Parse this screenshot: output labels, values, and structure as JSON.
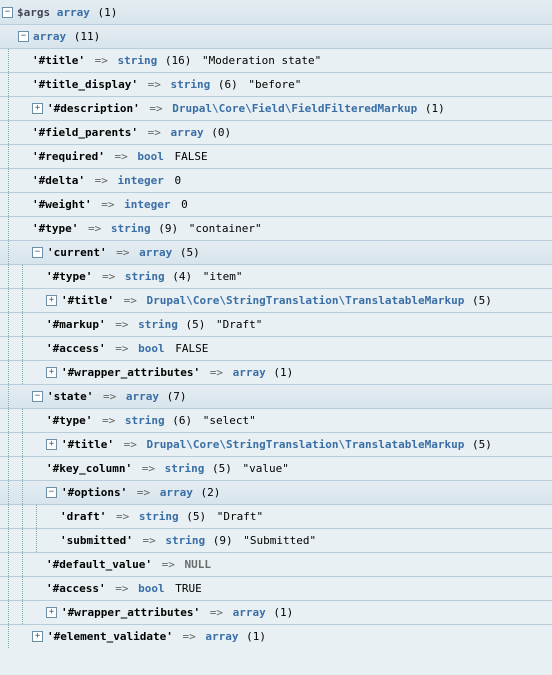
{
  "root": {
    "toggle": "−",
    "var": "$args",
    "type": "array",
    "len": "(1)"
  },
  "arr11": {
    "toggle": "−",
    "type": "array",
    "len": "(11)"
  },
  "items": {
    "title": {
      "key": "'#title'",
      "arrow": "=>",
      "type": "string",
      "len": "(16)",
      "val": "\"Moderation state\""
    },
    "titledisp": {
      "key": "'#title_display'",
      "arrow": "=>",
      "type": "string",
      "len": "(6)",
      "val": "\"before\""
    },
    "desc": {
      "toggle": "+",
      "key": "'#description'",
      "arrow": "=>",
      "type_class": "Drupal\\Core\\Field\\FieldFilteredMarkup",
      "len": "(1)"
    },
    "fieldpar": {
      "key": "'#field_parents'",
      "arrow": "=>",
      "type": "array",
      "len": "(0)"
    },
    "required": {
      "key": "'#required'",
      "arrow": "=>",
      "type": "bool",
      "val": "FALSE"
    },
    "delta": {
      "key": "'#delta'",
      "arrow": "=>",
      "type": "integer",
      "val": "0"
    },
    "weight": {
      "key": "'#weight'",
      "arrow": "=>",
      "type": "integer",
      "val": "0"
    },
    "typec": {
      "key": "'#type'",
      "arrow": "=>",
      "type": "string",
      "len": "(9)",
      "val": "\"container\""
    },
    "current": {
      "toggle": "−",
      "key": "'current'",
      "arrow": "=>",
      "type": "array",
      "len": "(5)"
    },
    "cur_type": {
      "key": "'#type'",
      "arrow": "=>",
      "type": "string",
      "len": "(4)",
      "val": "\"item\""
    },
    "cur_title": {
      "toggle": "+",
      "key": "'#title'",
      "arrow": "=>",
      "type_class": "Drupal\\Core\\StringTranslation\\TranslatableMarkup",
      "len": "(5)"
    },
    "cur_markup": {
      "key": "'#markup'",
      "arrow": "=>",
      "type": "string",
      "len": "(5)",
      "val": "\"Draft\""
    },
    "cur_access": {
      "key": "'#access'",
      "arrow": "=>",
      "type": "bool",
      "val": "FALSE"
    },
    "cur_wrap": {
      "toggle": "+",
      "key": "'#wrapper_attributes'",
      "arrow": "=>",
      "type": "array",
      "len": "(1)"
    },
    "state": {
      "toggle": "−",
      "key": "'state'",
      "arrow": "=>",
      "type": "array",
      "len": "(7)"
    },
    "st_type": {
      "key": "'#type'",
      "arrow": "=>",
      "type": "string",
      "len": "(6)",
      "val": "\"select\""
    },
    "st_title": {
      "toggle": "+",
      "key": "'#title'",
      "arrow": "=>",
      "type_class": "Drupal\\Core\\StringTranslation\\TranslatableMarkup",
      "len": "(5)"
    },
    "st_keycol": {
      "key": "'#key_column'",
      "arrow": "=>",
      "type": "string",
      "len": "(5)",
      "val": "\"value\""
    },
    "st_options": {
      "toggle": "−",
      "key": "'#options'",
      "arrow": "=>",
      "type": "array",
      "len": "(2)"
    },
    "opt_draft": {
      "key": "'draft'",
      "arrow": "=>",
      "type": "string",
      "len": "(5)",
      "val": "\"Draft\""
    },
    "opt_sub": {
      "key": "'submitted'",
      "arrow": "=>",
      "type": "string",
      "len": "(9)",
      "val": "\"Submitted\""
    },
    "st_default": {
      "key": "'#default_value'",
      "arrow": "=>",
      "type": "NULL"
    },
    "st_access": {
      "key": "'#access'",
      "arrow": "=>",
      "type": "bool",
      "val": "TRUE"
    },
    "st_wrap": {
      "toggle": "+",
      "key": "'#wrapper_attributes'",
      "arrow": "=>",
      "type": "array",
      "len": "(1)"
    },
    "elval": {
      "toggle": "+",
      "key": "'#element_validate'",
      "arrow": "=>",
      "type": "array",
      "len": "(1)"
    }
  }
}
